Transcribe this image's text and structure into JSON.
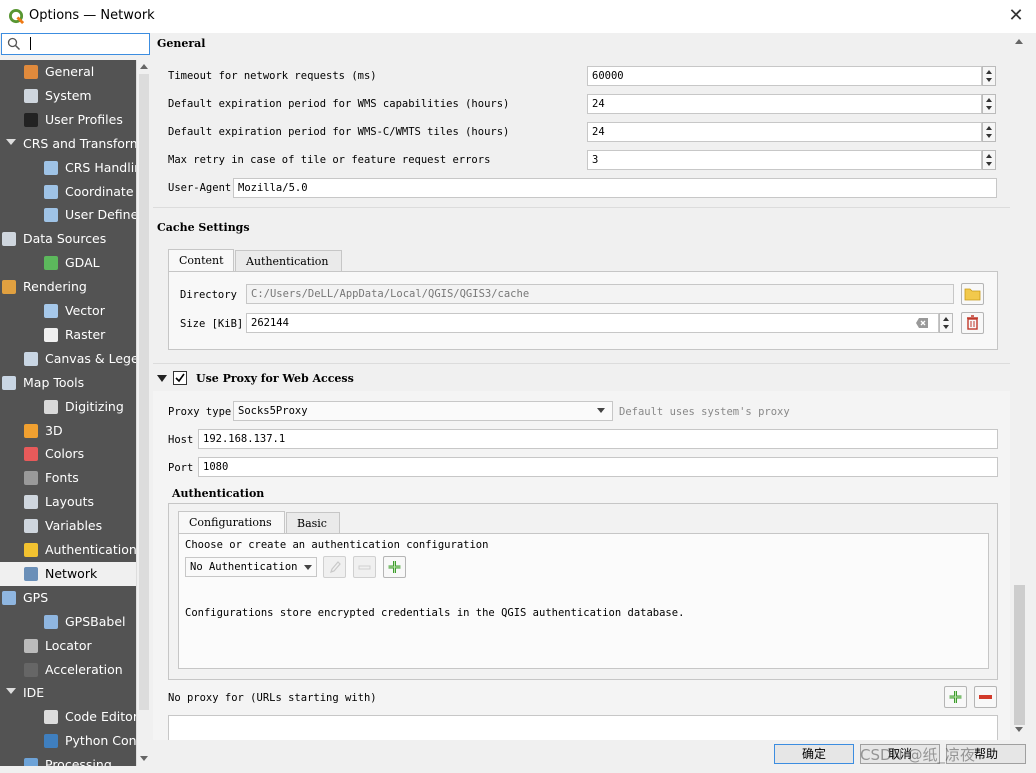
{
  "window": {
    "title": "Options — Network",
    "close_glyph": "✕"
  },
  "search": {
    "value": ""
  },
  "sidebar": {
    "items": [
      {
        "label": "General",
        "icon": "hammer-icon"
      },
      {
        "label": "System",
        "icon": "gear-icon"
      },
      {
        "label": "User Profiles",
        "icon": "user-icon"
      },
      {
        "label": "CRS and Transforms",
        "icon": ""
      },
      {
        "label": "CRS Handling",
        "icon": "globe-icon"
      },
      {
        "label": "Coordinate Transforms",
        "icon": "globe-icon"
      },
      {
        "label": "User Defined CRS",
        "icon": "globe-icon"
      },
      {
        "label": "Data Sources",
        "icon": "table-icon"
      },
      {
        "label": "GDAL",
        "icon": "gdal-icon"
      },
      {
        "label": "Rendering",
        "icon": "brush-icon"
      },
      {
        "label": "Vector",
        "icon": "vector-icon"
      },
      {
        "label": "Raster",
        "icon": "raster-icon"
      },
      {
        "label": "Canvas & Legend",
        "icon": "canvas-icon"
      },
      {
        "label": "Map Tools",
        "icon": "map-tools-icon"
      },
      {
        "label": "Digitizing",
        "icon": "digitizing-icon"
      },
      {
        "label": "3D",
        "icon": "3d-icon"
      },
      {
        "label": "Colors",
        "icon": "colors-icon"
      },
      {
        "label": "Fonts",
        "icon": "fonts-icon"
      },
      {
        "label": "Layouts",
        "icon": "layouts-icon"
      },
      {
        "label": "Variables",
        "icon": "variables-icon"
      },
      {
        "label": "Authentication",
        "icon": "lock-icon"
      },
      {
        "label": "Network",
        "icon": "network-icon"
      },
      {
        "label": "GPS",
        "icon": "gps-icon"
      },
      {
        "label": "GPSBabel",
        "icon": "gps-icon"
      },
      {
        "label": "Locator",
        "icon": "search-icon"
      },
      {
        "label": "Acceleration",
        "icon": "acceleration-icon"
      },
      {
        "label": "IDE",
        "icon": ""
      },
      {
        "label": "Code Editor",
        "icon": "code-editor-icon"
      },
      {
        "label": "Python Console",
        "icon": "python-icon"
      },
      {
        "label": "Processing",
        "icon": "processing-icon"
      }
    ],
    "selected": "Network"
  },
  "general": {
    "title": "General",
    "timeout_label": "Timeout for network requests (ms)",
    "timeout_value": "60000",
    "wms_cap_label": "Default expiration period for WMS capabilities (hours)",
    "wms_cap_value": "24",
    "wmts_label": "Default expiration period for WMS-C/WMTS tiles (hours)",
    "wmts_value": "24",
    "retry_label": "Max retry in case of tile or feature request errors",
    "retry_value": "3",
    "useragent_label": "User-Agent",
    "useragent_value": "Mozilla/5.0"
  },
  "cache": {
    "title": "Cache Settings",
    "tabs": [
      "Content",
      "Authentication"
    ],
    "directory_label": "Directory",
    "directory_value": "C:/Users/DeLL/AppData/Local/QGIS/QGIS3/cache",
    "size_label": "Size [KiB]",
    "size_value": "262144"
  },
  "proxy": {
    "title": "Use Proxy for Web Access",
    "checked": true,
    "type_label": "Proxy type",
    "type_value": "Socks5Proxy",
    "type_hint": "Default uses system's proxy",
    "host_label": "Host",
    "host_value": "192.168.137.1",
    "port_label": "Port",
    "port_value": "1080",
    "auth_title": "Authentication",
    "auth_tabs": [
      "Configurations",
      "Basic"
    ],
    "auth_choose": "Choose or create an authentication configuration",
    "auth_select": "No Authentication",
    "auth_note": "Configurations store encrypted credentials in the QGIS authentication database.",
    "no_proxy_label": "No proxy for (URLs starting with)"
  },
  "buttons": {
    "ok": "确定",
    "cancel": "取消",
    "help": "帮助"
  },
  "watermark": "CSDN @纸_凉夜",
  "colors": {
    "accent": "#3c8de0",
    "sidebar_bg": "#535353",
    "add_green": "#3d9a2f",
    "remove_red": "#d23a2a"
  }
}
